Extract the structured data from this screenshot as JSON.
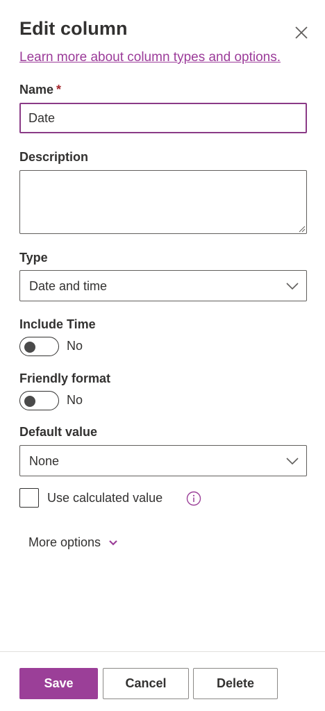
{
  "panel": {
    "title": "Edit column",
    "learn_more_link": "Learn more about column types and options."
  },
  "name_field": {
    "label": "Name",
    "required_marker": "*",
    "value": "Date"
  },
  "description_field": {
    "label": "Description",
    "value": ""
  },
  "type_field": {
    "label": "Type",
    "selected": "Date and time"
  },
  "include_time": {
    "label": "Include Time",
    "state_text": "No",
    "on": false
  },
  "friendly_format": {
    "label": "Friendly format",
    "state_text": "No",
    "on": false
  },
  "default_value": {
    "label": "Default value",
    "selected": "None"
  },
  "calculated": {
    "label": "Use calculated value",
    "checked": false
  },
  "more_options": {
    "label": "More options"
  },
  "footer": {
    "save_label": "Save",
    "cancel_label": "Cancel",
    "delete_label": "Delete"
  },
  "colors": {
    "accent": "#9b3f98",
    "link": "#9b3b99",
    "required": "#a4262c",
    "text": "#323130",
    "border": "#605e5c"
  },
  "icons": {
    "close": "close-icon",
    "chevron": "chevron-down-icon",
    "info": "info-icon"
  }
}
